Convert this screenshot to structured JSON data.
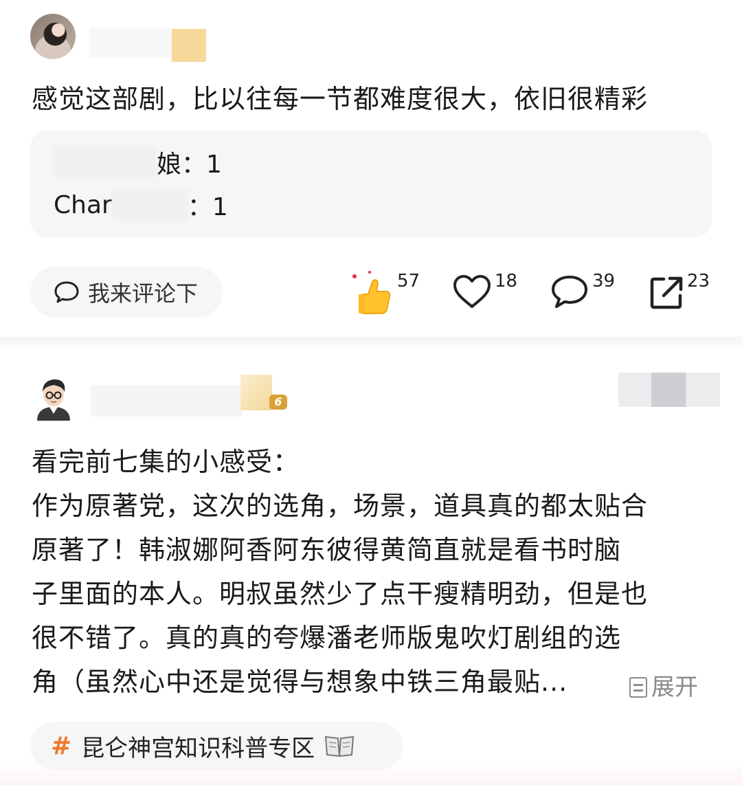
{
  "posts": [
    {
      "text": "感觉这部剧，比以往每一节都难度很大，依旧很精彩",
      "vote": [
        {
          "label": "娘：1"
        },
        {
          "prefix": "Char",
          "label": "：1"
        }
      ],
      "comment_placeholder": "我来评论下",
      "actions": {
        "like_count": "57",
        "heart_count": "18",
        "comment_count": "39",
        "share_count": "23"
      }
    },
    {
      "level_badge": "6",
      "text": "看完前七集的小感受：\n作为原著党，这次的选角，场景，道具真的都太贴合\n原著了！韩淑娜阿香阿东彼得黄简直就是看书时脑\n子里面的本人。明叔虽然少了点干瘦精明劲，但是也\n很不错了。真的真的夸爆潘老师版鬼吹灯剧组的选\n角（虽然心中还是觉得与想象中铁三角最贴...",
      "expand_label": "展开",
      "topic": "昆仑神宫知识科普专区"
    }
  ],
  "colors": {
    "accent_orange": "#f07a2a",
    "muted_gray": "#8a8a8f",
    "pill_bg": "#f6f6f7"
  },
  "icons": [
    "chat-bubble-icon",
    "thumbs-up-icon",
    "heart-icon",
    "comment-icon",
    "share-icon",
    "expand-icon",
    "hash-icon",
    "book-icon"
  ]
}
